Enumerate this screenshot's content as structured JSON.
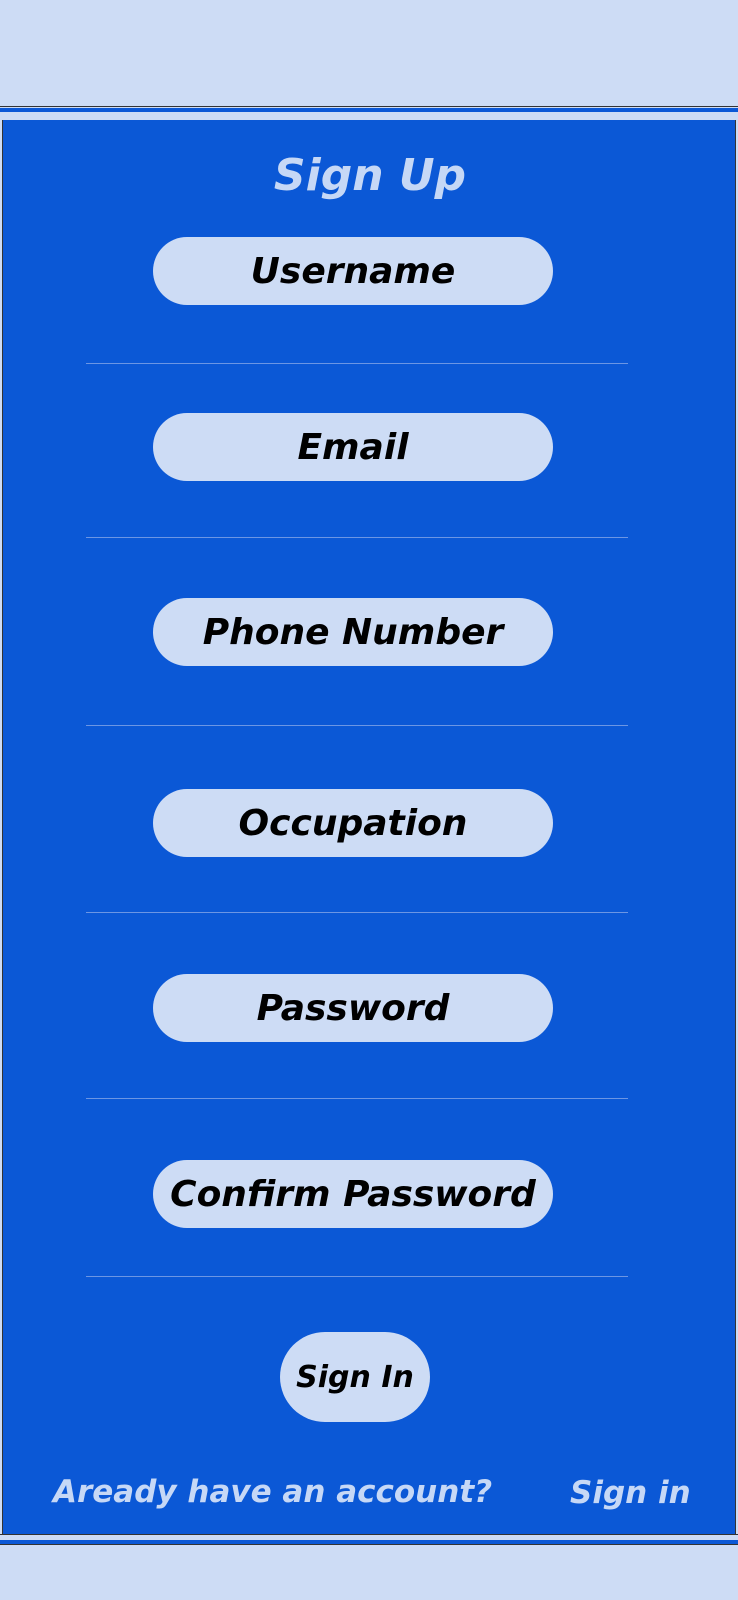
{
  "colors": {
    "panel_bg": "#0b58d6",
    "page_bg": "#cddcf5",
    "field_bg": "#cddcf5",
    "light_text": "#c6d8f6",
    "dark_text": "#000000"
  },
  "form": {
    "title": "Sign Up",
    "fields": [
      {
        "placeholder": "Username"
      },
      {
        "placeholder": "Email"
      },
      {
        "placeholder": "Phone Number"
      },
      {
        "placeholder": "Occupation"
      },
      {
        "placeholder": "Password"
      },
      {
        "placeholder": "Confirm Password"
      }
    ],
    "submit_label": "Sign In"
  },
  "footer": {
    "prompt": "Aready have an account?",
    "link_label": "Sign in"
  }
}
